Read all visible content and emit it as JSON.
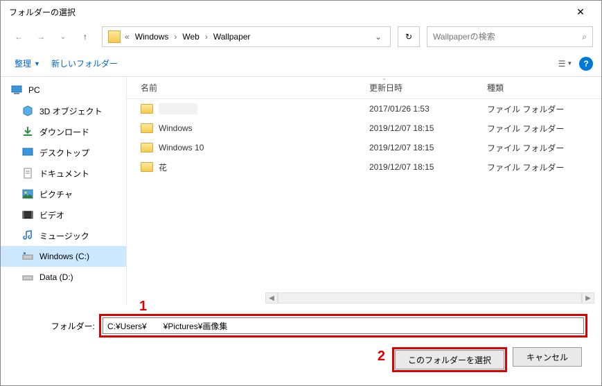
{
  "title": "フォルダーの選択",
  "breadcrumb": {
    "segments": [
      "Windows",
      "Web",
      "Wallpaper"
    ]
  },
  "search": {
    "placeholder": "Wallpaperの検索"
  },
  "toolbar": {
    "organize": "整理",
    "newfolder": "新しいフォルダー"
  },
  "columns": {
    "name": "名前",
    "date": "更新日時",
    "type": "種類"
  },
  "sidebar": {
    "items": [
      {
        "label": "PC"
      },
      {
        "label": "3D オブジェクト"
      },
      {
        "label": "ダウンロード"
      },
      {
        "label": "デスクトップ"
      },
      {
        "label": "ドキュメント"
      },
      {
        "label": "ピクチャ"
      },
      {
        "label": "ビデオ"
      },
      {
        "label": "ミュージック"
      },
      {
        "label": "Windows (C:)"
      },
      {
        "label": "Data (D:)"
      }
    ]
  },
  "files": [
    {
      "name": "",
      "date": "2017/01/26 1:53",
      "type": "ファイル フォルダー",
      "blurred": true
    },
    {
      "name": "Windows",
      "date": "2019/12/07 18:15",
      "type": "ファイル フォルダー"
    },
    {
      "name": "Windows 10",
      "date": "2019/12/07 18:15",
      "type": "ファイル フォルダー"
    },
    {
      "name": "花",
      "date": "2019/12/07 18:15",
      "type": "ファイル フォルダー"
    }
  ],
  "folder_label": "フォルダー:",
  "folder_value": "C:¥Users¥　　¥Pictures¥画像集",
  "buttons": {
    "select": "このフォルダーを選択",
    "cancel": "キャンセル"
  },
  "annotations": {
    "one": "1",
    "two": "2"
  }
}
